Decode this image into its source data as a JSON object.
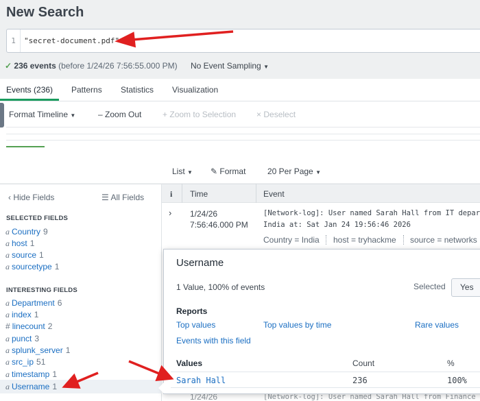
{
  "page_title": "New Search",
  "search": {
    "line_number": "1",
    "query": "\"secret-document.pdf\""
  },
  "status": {
    "count": "236 events",
    "range": "(before 1/24/26 7:56:55.000 PM)",
    "sampling": "No Event Sampling"
  },
  "tabs": [
    "Events (236)",
    "Patterns",
    "Statistics",
    "Visualization"
  ],
  "timeline": {
    "format": "Format Timeline",
    "zoom_out": "Zoom Out",
    "zoom_selection": "Zoom to Selection",
    "deselect": "Deselect"
  },
  "results_toolbar": {
    "list": "List",
    "format": "Format",
    "per_page": "20 Per Page"
  },
  "fields_panel": {
    "hide": "Hide Fields",
    "all": "All Fields",
    "selected_title": "SELECTED FIELDS",
    "selected": [
      {
        "type": "a",
        "name": "Country",
        "count": "9"
      },
      {
        "type": "a",
        "name": "host",
        "count": "1"
      },
      {
        "type": "a",
        "name": "source",
        "count": "1"
      },
      {
        "type": "a",
        "name": "sourcetype",
        "count": "1"
      }
    ],
    "interesting_title": "INTERESTING FIELDS",
    "interesting": [
      {
        "type": "a",
        "name": "Department",
        "count": "6"
      },
      {
        "type": "a",
        "name": "index",
        "count": "1"
      },
      {
        "type": "#",
        "name": "linecount",
        "count": "2"
      },
      {
        "type": "a",
        "name": "punct",
        "count": "3"
      },
      {
        "type": "a",
        "name": "splunk_server",
        "count": "1"
      },
      {
        "type": "a",
        "name": "src_ip",
        "count": "51"
      },
      {
        "type": "a",
        "name": "timestamp",
        "count": "1"
      },
      {
        "type": "a",
        "name": "Username",
        "count": "1"
      }
    ]
  },
  "events_table": {
    "headers": {
      "info": "i",
      "time": "Time",
      "event": "Event"
    },
    "row": {
      "date": "1/24/26",
      "time": "7:56:46.000 PM",
      "line1": "[Network-log]: User named Sarah Hall from IT departm",
      "line2": "India at: Sat Jan 24 19:56:46 2026",
      "kv_country": "Country = India",
      "kv_host": "host = tryhackme",
      "kv_source": "source = networks"
    },
    "next_row": {
      "date": "1/24/26",
      "text": "[Network-log]: User named Sarah Hall from Finance de"
    }
  },
  "field_popup": {
    "title": "Username",
    "summary": "1 Value, 100% of events",
    "selected_label": "Selected",
    "yes": "Yes",
    "reports_title": "Reports",
    "links": [
      "Top values",
      "Top values by time",
      "Rare values",
      "Events with this field"
    ],
    "values_header": {
      "values": "Values",
      "count": "Count",
      "pct": "%"
    },
    "values": [
      {
        "value": "Sarah Hall",
        "count": "236",
        "pct": "100%"
      }
    ]
  },
  "colors": {
    "accent_green": "#1a9c5e",
    "link_blue": "#1a6ec2",
    "annotation_red": "#e02020"
  }
}
